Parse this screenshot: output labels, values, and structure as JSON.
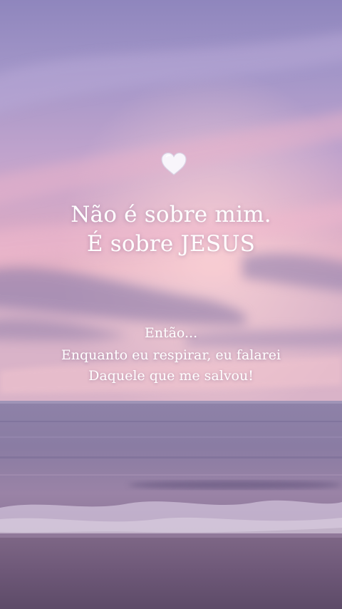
{
  "scene": {
    "description_colors": {
      "sky_top": "#9c8dc2",
      "sky_mid": "#c7a3cc",
      "horizon_pink": "#f0b9c8",
      "sea": "#7d6d95",
      "sand": "#6f5b79"
    },
    "heart_icon": "white-heart"
  },
  "message": {
    "line1": "Não é sobre mim.",
    "line2": "É sobre JESUS",
    "line3": "Então...",
    "line4": "Enquanto eu respirar, eu falarei",
    "line5": "Daquele que me salvou!"
  }
}
